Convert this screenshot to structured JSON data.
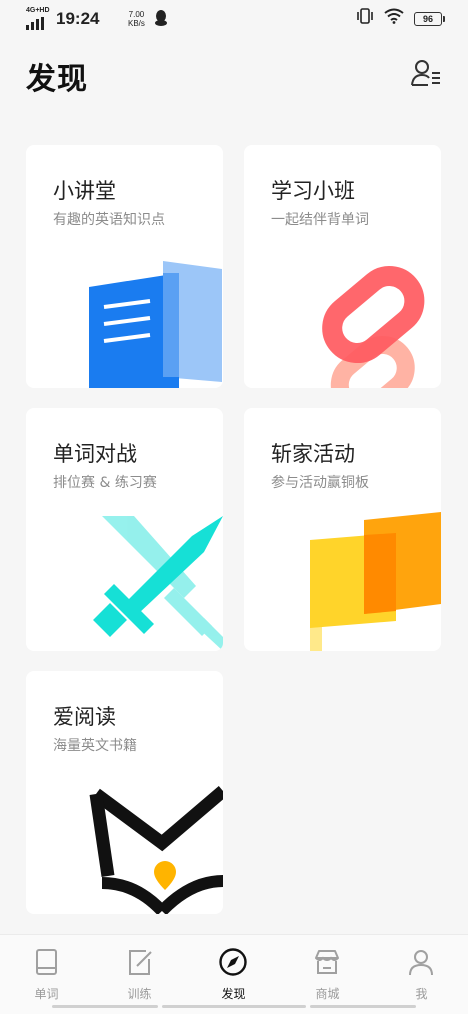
{
  "status_bar": {
    "network": "4G+HD",
    "time": "19:24",
    "speed_value": "7.00",
    "speed_unit": "KB/s",
    "battery": "96",
    "icons": [
      "signal-icon",
      "qq-icon",
      "vibrate-icon",
      "wifi-icon",
      "battery-icon"
    ]
  },
  "header": {
    "title": "发现",
    "profile_icon": "user-list-icon"
  },
  "cards": [
    {
      "title": "小讲堂",
      "subtitle": "有趣的英语知识点",
      "icon": "document-icon"
    },
    {
      "title": "学习小班",
      "subtitle": "一起结伴背单词",
      "icon": "chain-link-icon"
    },
    {
      "title": "单词对战",
      "subtitle": "排位赛 & 练习赛",
      "icon": "crossed-swords-icon"
    },
    {
      "title": "斩家活动",
      "subtitle": "参与活动赢铜板",
      "icon": "flag-icon"
    },
    {
      "title": "爱阅读",
      "subtitle": "海量英文书籍",
      "icon": "open-book-icon"
    }
  ],
  "tabbar": {
    "tabs": [
      {
        "label": "单词",
        "icon": "book-icon",
        "active": false
      },
      {
        "label": "训练",
        "icon": "edit-icon",
        "active": false
      },
      {
        "label": "发现",
        "icon": "compass-icon",
        "active": true
      },
      {
        "label": "商城",
        "icon": "store-icon",
        "active": false
      },
      {
        "label": "我",
        "icon": "person-icon",
        "active": false
      }
    ]
  },
  "colors": {
    "background": "#f6f6f6",
    "card": "#ffffff",
    "blue": "#1a7cf0",
    "red": "#ff5a5f",
    "cyan": "#16e0d6",
    "yellow": "#ffd42a",
    "orange": "#ff9f00"
  }
}
